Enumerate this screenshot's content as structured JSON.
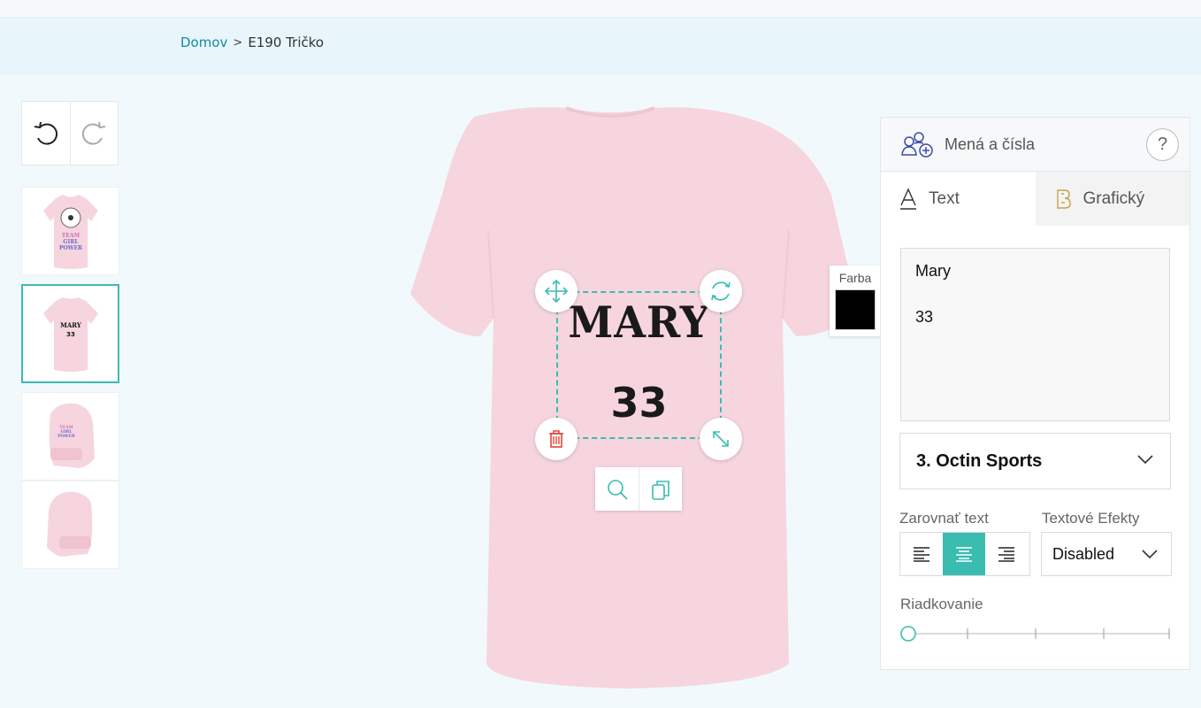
{
  "breadcrumb": {
    "home": "Domov",
    "separator": ">",
    "current": "E190 Tričko"
  },
  "history": {
    "undo_icon": "undo-icon",
    "redo_icon": "redo-icon"
  },
  "thumbnails": [
    {
      "view": "front",
      "lines": [
        "TEAM",
        "GIRL",
        "POWER"
      ]
    },
    {
      "view": "back",
      "lines": [
        "MARY",
        "33"
      ],
      "active": true
    },
    {
      "view": "left-sleeve",
      "lines": [
        "TEAM",
        "GIRL",
        "POWER"
      ]
    },
    {
      "view": "right-sleeve",
      "lines": []
    }
  ],
  "design": {
    "line1": "MARY",
    "line2": "33",
    "text_color": "#000000",
    "shirt_color": "#f6d5de",
    "accent": "#3abcb0"
  },
  "color_picker": {
    "label": "Farba",
    "value": "#000000"
  },
  "panel": {
    "header_title": "Mená a čísla",
    "help": "?",
    "tabs": [
      {
        "label": "Text",
        "active": true
      },
      {
        "label": "Grafický",
        "active": false
      }
    ],
    "text_value": "Mary\n\n33",
    "font_selected": "3. Octin Sports",
    "align_label": "Zarovnať text",
    "align_selected": "center",
    "effects_label": "Textové Efekty",
    "effects_selected": "Disabled",
    "spacing_label": "Riadkovanie",
    "spacing_value": 0
  }
}
